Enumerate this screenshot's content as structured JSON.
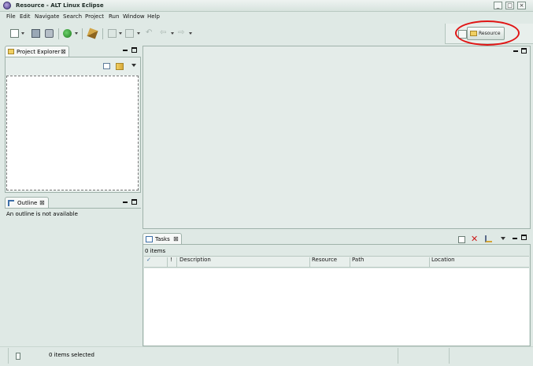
{
  "window": {
    "title": "Resource - ALT Linux Eclipse"
  },
  "menu": [
    "File",
    "Edit",
    "Navigate",
    "Search",
    "Project",
    "Run",
    "Window",
    "Help"
  ],
  "perspective": {
    "label": "Resource"
  },
  "project_explorer": {
    "tab_label": "Project Explorer"
  },
  "outline": {
    "tab_label": "Outline",
    "message": "An outline is not available"
  },
  "tasks": {
    "tab_label": "Tasks",
    "count_text": "0 items",
    "columns": [
      "✓",
      "!",
      "Description",
      "Resource",
      "Path",
      "Location"
    ]
  },
  "status": {
    "text": "0 items selected"
  },
  "colors": {
    "highlight_ellipse": "#e01515",
    "background": "#dfe9e5"
  }
}
